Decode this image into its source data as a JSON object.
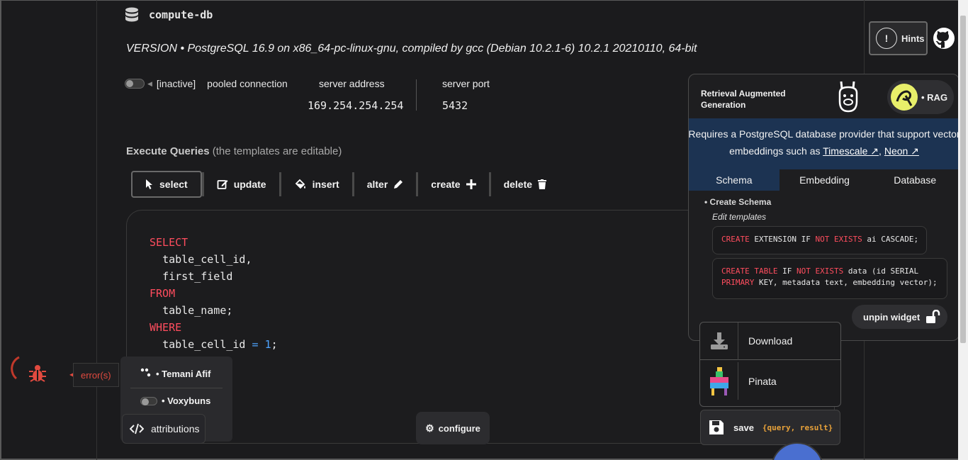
{
  "header": {
    "db_name": "compute-db",
    "version": "VERSION • PostgreSQL 16.9 on x86_64-pc-linux-gnu, compiled by gcc (Debian 10.2.1-6) 10.2.1 20210110, 64-bit"
  },
  "connection": {
    "status": "[inactive]",
    "pooled_label": "pooled connection",
    "server_address_label": "server address",
    "server_address": "169.254.254.254",
    "server_port_label": "server port",
    "server_port": "5432"
  },
  "queries": {
    "title": "Execute Queries",
    "subtitle": "(the templates are editable)",
    "buttons": [
      "select",
      "update",
      "insert",
      "alter",
      "create",
      "delete"
    ],
    "active": "select",
    "code": {
      "l1": "SELECT",
      "l2": "table_cell_id,",
      "l3": "first_field",
      "l4": "FROM",
      "l5": "table_name;",
      "l6": "WHERE",
      "l7a": "table_cell_id",
      "l7b": "=",
      "l7c": "1",
      "l7d": ";"
    }
  },
  "errors": {
    "label": "error(s)"
  },
  "attributions": {
    "items": [
      "• Temani Afif",
      "• Voxybuns"
    ],
    "button": "attributions"
  },
  "configure": {
    "label": "configure"
  },
  "hints": {
    "icon": "!",
    "label": "Hints"
  },
  "rag": {
    "title": "Retrieval Augmented Generation",
    "badge": "• RAG",
    "note_prefix": "Requires a PostgreSQL database provider that support vector embeddings such as",
    "link1": "Timescale ↗",
    "link_sep": ",",
    "link2": "Neon ↗",
    "tabs": [
      "Schema",
      "Embedding",
      "Database"
    ],
    "active_tab": "Schema",
    "bullet": "Create Schema",
    "edit": "Edit templates",
    "code1": {
      "a": "CREATE",
      "b": " EXTENSION IF ",
      "c": "NOT EXISTS",
      "d": " ai CASCADE;"
    },
    "code2": {
      "a": "CREATE TABLE",
      "b": " IF ",
      "c": "NOT EXISTS",
      "d": " data (id SERIAL",
      "e": "PRIMARY",
      "f": " KEY, metadata text, embedding vector);"
    },
    "unpin": "unpin widget"
  },
  "download_menu": {
    "items": [
      "Download",
      "Pinata"
    ]
  },
  "save": {
    "label": "save",
    "template": "{query, result}"
  },
  "colors": {
    "keyword": "#ff4d5e",
    "number": "#4ea3ff",
    "rag_blue": "#1c3352",
    "error": "#e24a3f",
    "template": "#e8a23a"
  }
}
